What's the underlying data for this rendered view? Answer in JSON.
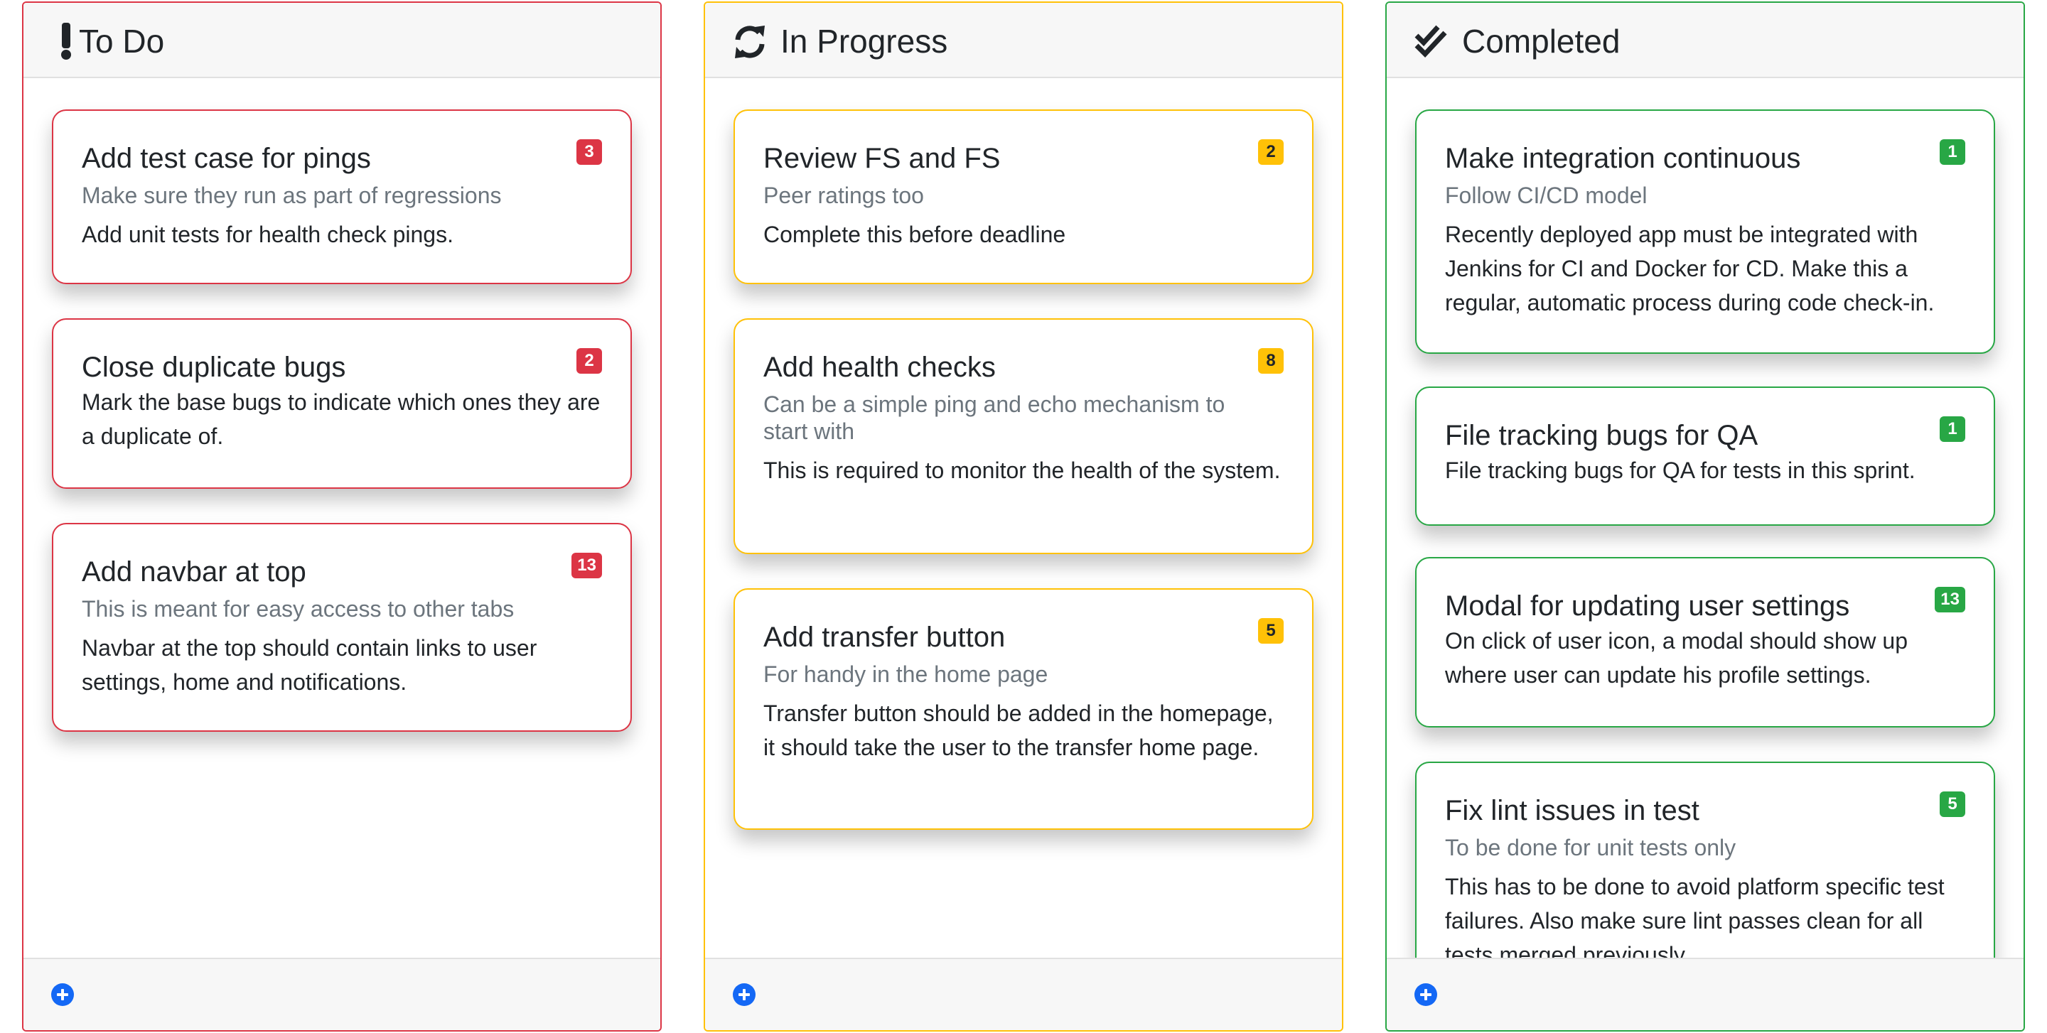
{
  "theme": {
    "todo_color": "#dc3545",
    "progress_color": "#ffc107",
    "done_color": "#28a745",
    "add_button_color": "#1468f5"
  },
  "columns": [
    {
      "title": "To Do",
      "icon": "exclamation-icon",
      "cards": [
        {
          "title": "Add test case for pings",
          "points": "3",
          "subtitle": "Make sure they run as part of regressions",
          "text": "Add unit tests for health check pings."
        },
        {
          "title": "Close duplicate bugs",
          "points": "2",
          "subtitle": "",
          "text": "Mark the base bugs to indicate which ones they are a duplicate of."
        },
        {
          "title": "Add navbar at top",
          "points": "13",
          "subtitle": "This is meant for easy access to other tabs",
          "text": "Navbar at the top should contain links to user settings, home and notifications."
        }
      ]
    },
    {
      "title": "In Progress",
      "icon": "sync-icon",
      "cards": [
        {
          "title": "Review FS and FS",
          "points": "2",
          "subtitle": "Peer ratings too",
          "text": "Complete this before deadline"
        },
        {
          "title": "Add health checks",
          "points": "8",
          "subtitle": "Can be a simple ping and echo mechanism to start with",
          "text": "This is required to monitor the health of the system."
        },
        {
          "title": "Add transfer button",
          "points": "5",
          "subtitle": "For handy in the home page",
          "text": "Transfer button should be added in the homepage, it should take the user to the transfer home page."
        }
      ]
    },
    {
      "title": "Completed",
      "icon": "double-check-icon",
      "cards": [
        {
          "title": "Make integration continuous",
          "points": "1",
          "subtitle": "Follow CI/CD model",
          "text": "Recently deployed app must be integrated with Jenkins for CI and Docker for CD. Make this a regular, automatic process during code check-in."
        },
        {
          "title": "File tracking bugs for QA",
          "points": "1",
          "subtitle": "",
          "text": "File tracking bugs for QA for tests in this sprint."
        },
        {
          "title": "Modal for updating user settings",
          "points": "13",
          "subtitle": "",
          "text": "On click of user icon, a modal should show up where user can update his profile settings."
        },
        {
          "title": "Fix lint issues in test",
          "points": "5",
          "subtitle": "To be done for unit tests only",
          "text": "This has to be done to avoid platform specific test failures. Also make sure lint passes clean for all tests merged previously."
        }
      ]
    }
  ]
}
